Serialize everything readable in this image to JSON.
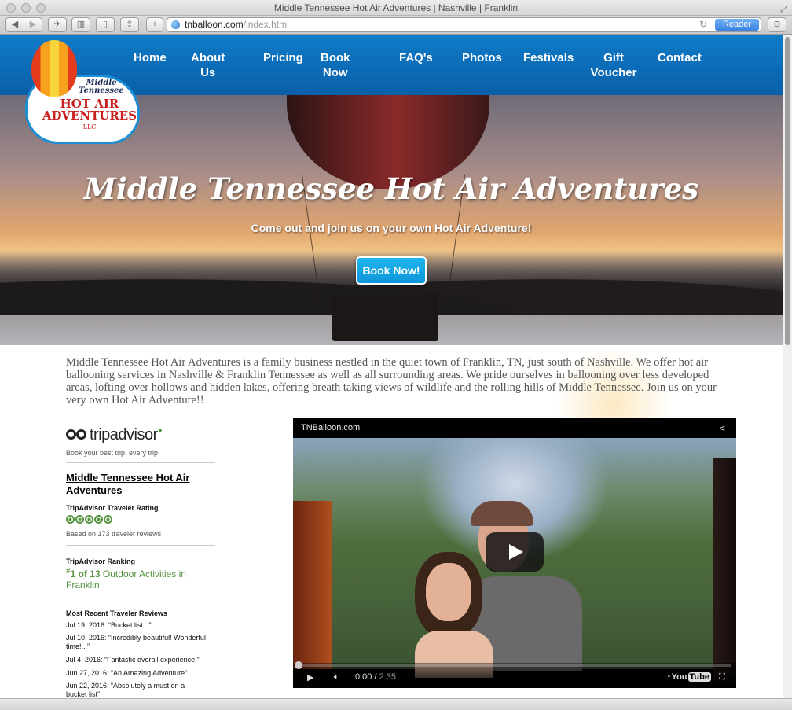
{
  "browser": {
    "window_title": "Middle Tennessee Hot Air Adventures | Nashville | Franklin",
    "url_domain": "tnballoon.com",
    "url_path": "/index.html",
    "reader_label": "Reader"
  },
  "nav": {
    "items": [
      {
        "label": "Home"
      },
      {
        "label": "About Us"
      },
      {
        "label": "Pricing"
      },
      {
        "label": "Book Now"
      },
      {
        "label": "FAQ's"
      },
      {
        "label": "Photos"
      },
      {
        "label": "Festivals"
      },
      {
        "label": "Gift Voucher"
      },
      {
        "label": "Contact"
      }
    ]
  },
  "logo": {
    "line1": "Middle Tennessee",
    "line2": "HOT AIR ADVENTURES",
    "line3": "LLC"
  },
  "hero": {
    "title": "Middle Tennessee Hot Air Adventures",
    "subtitle": "Come out and join us on your own Hot Air Adventure!",
    "button": "Book Now!"
  },
  "intro": {
    "text": "Middle Tennessee Hot Air Adventures is a family business nestled in the quiet town of Franklin, TN, just south of Nashville. We offer hot air ballooning services in Nashville & Franklin Tennessee as well as all surrounding areas. We pride ourselves in ballooning over less developed areas, lofting over hollows and hidden lakes, offering breath taking views of wildlife and the rolling hills of Middle Tennessee. Join us on your very own Hot Air Adventure!!"
  },
  "tripadvisor": {
    "logo": "tripadvisor",
    "tagline": "Book your best trip, every trip",
    "business_name": "Middle Tennessee Hot Air Adventures",
    "rating_heading": "TripAdvisor Traveler Rating",
    "rating_bubbles": 5,
    "reviews_count": "Based on 173 traveler reviews",
    "ranking_heading": "TripAdvisor Ranking",
    "ranking_prefix": "#",
    "ranking_text": "1 of 13",
    "ranking_rest": "Outdoor Activities in Franklin",
    "recent_heading": "Most Recent Traveler Reviews",
    "reviews": [
      {
        "text": "Jul 19, 2016: “Bucket list...”"
      },
      {
        "text": "Jul 10, 2016: “Incredibly beautiful! Wonderful time!...”"
      },
      {
        "text": "Jul 4, 2016: “Fantastic overall experience.”"
      },
      {
        "text": "Jun 27, 2016: “An Amazing Adventure”"
      },
      {
        "text": "Jun 22, 2016: “Absolutely a must on a bucket list”"
      }
    ]
  },
  "video": {
    "title": "TNBalloon.com",
    "time_current": "0:00",
    "time_total": "2:35",
    "progress": 0,
    "brand": "YouTube"
  }
}
